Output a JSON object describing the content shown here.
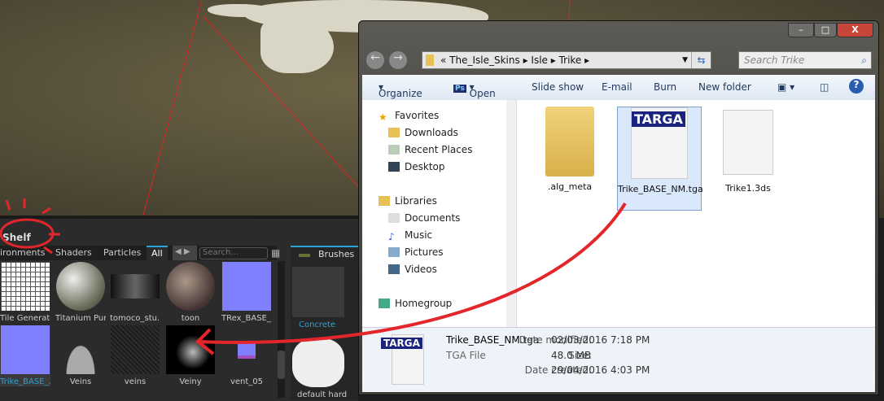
{
  "shelf": {
    "title": "Shelf",
    "tabs": [
      "ironments",
      "Shaders",
      "Particles",
      "All"
    ],
    "search_placeholder": "Search...",
    "items": [
      {
        "label": "Tile Generator"
      },
      {
        "label": "Titanium Pure"
      },
      {
        "label": "tomoco_stu..."
      },
      {
        "label": "toon"
      },
      {
        "label": "TRex_BASE_..."
      },
      {
        "label": "Trike_BASE_...",
        "selected": true
      },
      {
        "label": "Veins"
      },
      {
        "label": "veins"
      },
      {
        "label": "Veiny"
      },
      {
        "label": "vent_05"
      }
    ],
    "brushes": {
      "title": "Brushes",
      "items": [
        "Concrete",
        "default hard"
      ]
    }
  },
  "explorer": {
    "window_controls": {
      "minimize": "–",
      "maximize": "□",
      "close": "X"
    },
    "breadcrumb": [
      "The_Isle_Skins",
      "Isle",
      "Trike"
    ],
    "search_placeholder": "Search Trike",
    "toolbar": {
      "organize": "Organize",
      "open": "Open",
      "slideshow": "Slide show",
      "email": "E-mail",
      "burn": "Burn",
      "new_folder": "New folder"
    },
    "nav": {
      "favorites": "Favorites",
      "fav_items": [
        "Downloads",
        "Recent Places",
        "Desktop"
      ],
      "libraries": "Libraries",
      "lib_items": [
        "Documents",
        "Music",
        "Pictures",
        "Videos"
      ],
      "homegroup": "Homegroup"
    },
    "files": [
      {
        "name": ".alg_meta",
        "type": "folder"
      },
      {
        "name": "Trike_BASE_NM.tga",
        "type": "targa",
        "selected": true
      },
      {
        "name": "Trike1.3ds",
        "type": "file"
      }
    ],
    "targa_badge": "TARGA",
    "details": {
      "name": "Trike_BASE_NM.tga",
      "type": "TGA File",
      "modified_label": "Date modified:",
      "modified": "02/03/2016 7:18 PM",
      "size_label": "Size:",
      "size": "48.0 MB",
      "created_label": "Date created:",
      "created": "29/04/2016 4:03 PM"
    }
  },
  "colors": {
    "accent": "#2aa3d8",
    "annotation": "#e3262b",
    "normal_map": "#8080ff"
  }
}
